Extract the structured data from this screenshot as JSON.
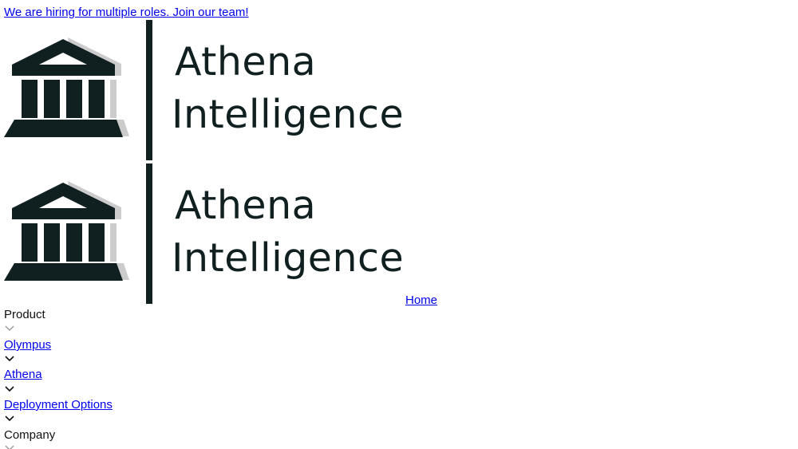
{
  "banner": {
    "text": "We are hiring for multiple roles. Join our team!"
  },
  "logo": {
    "line1": "Athena",
    "line2": "Intelligence",
    "color": "#101f1f",
    "shadow_color": "#cccccc"
  },
  "nav": {
    "home_label": "Home",
    "items": [
      {
        "label": "Product",
        "is_link": false
      },
      {
        "label": "Olympus",
        "is_link": true
      },
      {
        "label": "Athena",
        "is_link": true
      },
      {
        "label": "Deployment Options",
        "is_link": true
      },
      {
        "label": "Company",
        "is_link": false
      }
    ],
    "chevron_icon": "chevron-down-icon"
  }
}
